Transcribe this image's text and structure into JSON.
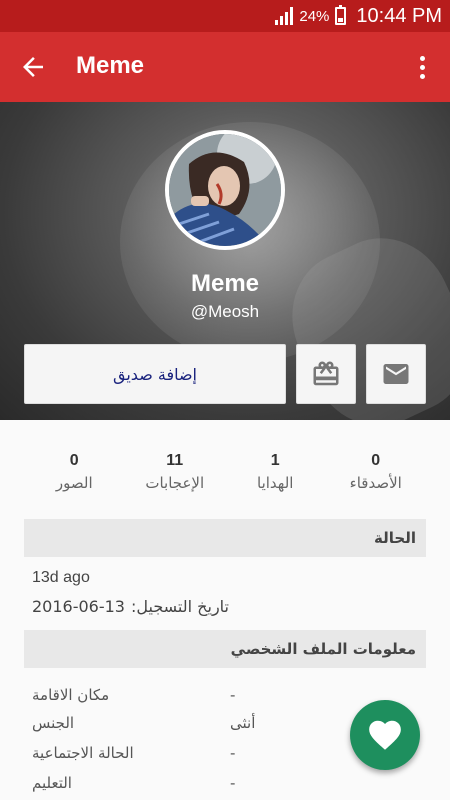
{
  "status_bar": {
    "battery": "24%",
    "time": "10:44 PM"
  },
  "app_bar": {
    "title": "Meme",
    "back_icon": "arrow-back-icon",
    "menu_icon": "more-vert-icon"
  },
  "profile": {
    "name": "Meme",
    "handle": "@Meosh"
  },
  "actions": {
    "add_friend_label": "إضافة صديق",
    "gift_icon": "gift-icon",
    "message_icon": "mail-icon"
  },
  "stats": [
    {
      "value": "0",
      "label": "الصور"
    },
    {
      "value": "11",
      "label": "الإعجابات"
    },
    {
      "value": "1",
      "label": "الهدايا"
    },
    {
      "value": "0",
      "label": "الأصدقاء"
    }
  ],
  "status_section": {
    "title": "الحالة",
    "text": "13d ago",
    "registration_label": "تاريخ التسجيل:",
    "registration_date": "2016-06-13"
  },
  "profile_info": {
    "title": "معلومات الملف الشخصي",
    "rows": [
      {
        "label": "مكان الاقامة",
        "value": "-"
      },
      {
        "label": "الجنس",
        "value": "أنثى"
      },
      {
        "label": "الحالة الاجتماعية",
        "value": "-"
      },
      {
        "label": "التعليم",
        "value": "-"
      }
    ]
  },
  "fab": {
    "icon": "heart-icon"
  },
  "colors": {
    "status_bar": "#b71c1c",
    "app_bar": "#d32f2f",
    "fab": "#1e8f5e"
  }
}
